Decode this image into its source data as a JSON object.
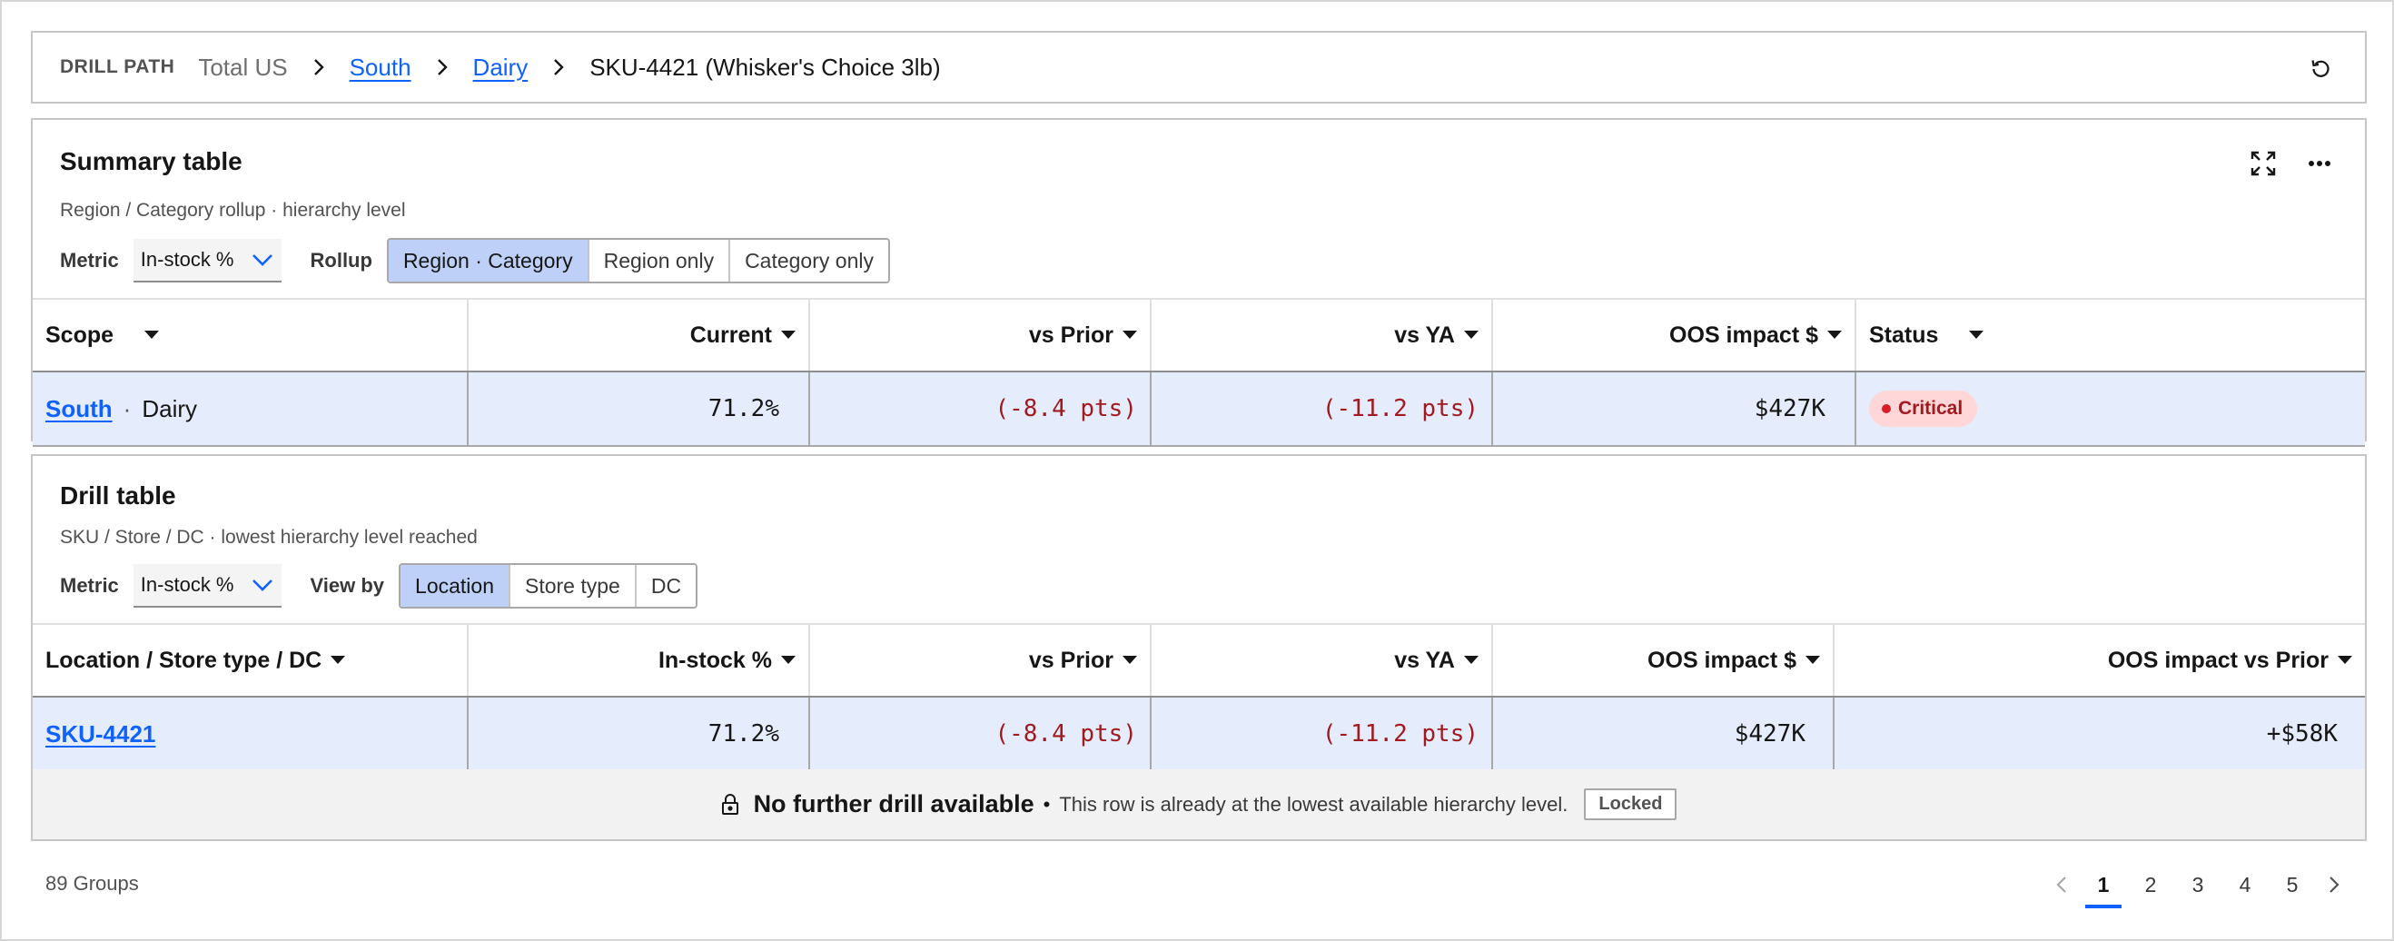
{
  "breadcrumb": {
    "label": "DRILL PATH",
    "root": "Total US",
    "links": [
      "South",
      "Dairy"
    ],
    "current": "SKU-4421 (Whisker's Choice 3lb)"
  },
  "summary": {
    "title": "Summary table",
    "subtitle": "Region / Category rollup · hierarchy level",
    "metric_label": "Metric",
    "metric_value": "In-stock %",
    "rollup_label": "Rollup",
    "rollup_options": [
      "Region · Category",
      "Region only",
      "Category only"
    ],
    "rollup_selected": "Region · Category",
    "columns": [
      "Scope",
      "Current",
      "vs Prior",
      "vs YA",
      "OOS impact $",
      "Status"
    ],
    "row": {
      "scope_link": "South",
      "scope_sep": "·",
      "scope_rest": "Dairy",
      "current": "71.2%",
      "vs_prior": "(-8.4 pts)",
      "vs_ya": "(-11.2 pts)",
      "oos_impact": "$427K",
      "status": "Critical"
    }
  },
  "drill": {
    "title": "Drill table",
    "subtitle": "SKU / Store / DC · lowest hierarchy level reached",
    "metric_label": "Metric",
    "metric_value": "In-stock %",
    "viewby_label": "View by",
    "viewby_options": [
      "Location",
      "Store type",
      "DC"
    ],
    "viewby_selected": "Location",
    "columns": [
      "Location / Store type / DC",
      "In-stock %",
      "vs Prior",
      "vs YA",
      "OOS impact $",
      "OOS impact vs Prior"
    ],
    "row": {
      "location": "SKU-4421",
      "instock": "71.2%",
      "vs_prior": "(-8.4 pts)",
      "vs_ya": "(-11.2 pts)",
      "oos_impact": "$427K",
      "oos_vs_prior": "+$58K"
    },
    "notice": {
      "title": "No further drill available",
      "bullet": "•",
      "text": "This row is already at the lowest available hierarchy level.",
      "tag": "Locked"
    }
  },
  "footer": {
    "groups": "89 Groups",
    "pages": [
      "1",
      "2",
      "3",
      "4",
      "5"
    ],
    "current_page": "1"
  },
  "colors": {
    "link": "#0f62fe",
    "negative": "#a2191f",
    "row_highlight": "#e5ecfb",
    "segment_active": "#bed0f7",
    "critical_bg": "#ffd7d9"
  }
}
